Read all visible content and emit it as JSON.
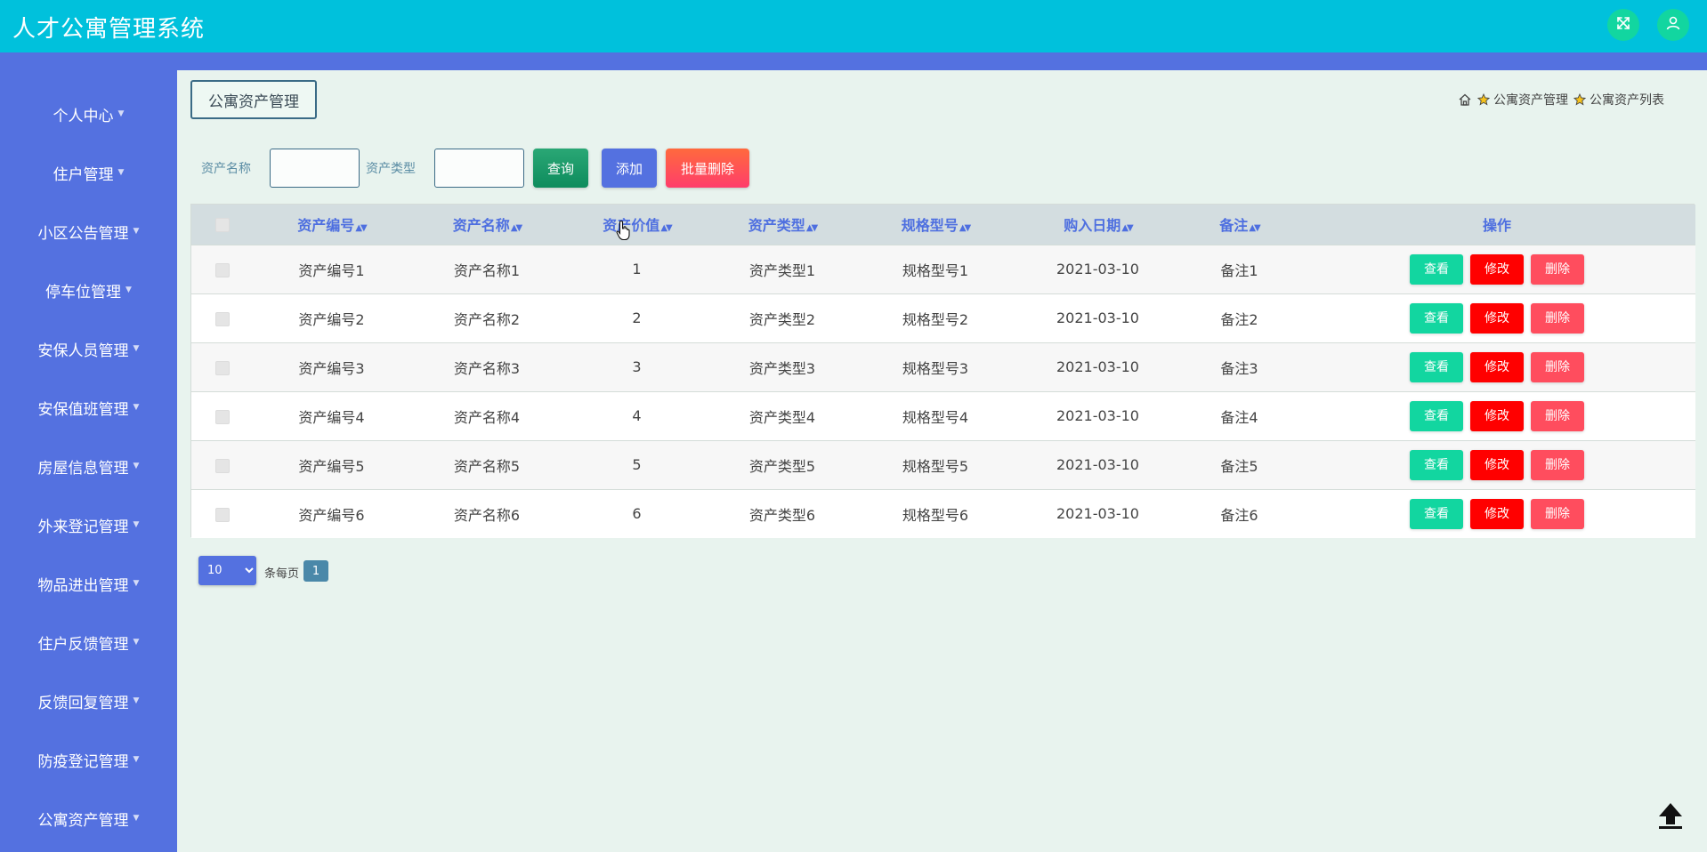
{
  "header": {
    "title": "人才公寓管理系统",
    "icons": [
      "expand-icon",
      "user-icon"
    ],
    "colors": {
      "header_bg": "#00c1dc",
      "accent": "#5471e0",
      "icon_btn": "#12d6a0"
    }
  },
  "sidebar": {
    "items": [
      {
        "label": "个人中心"
      },
      {
        "label": "住户管理"
      },
      {
        "label": "小区公告管理"
      },
      {
        "label": "停车位管理"
      },
      {
        "label": "安保人员管理"
      },
      {
        "label": "安保值班管理"
      },
      {
        "label": "房屋信息管理"
      },
      {
        "label": "外来登记管理"
      },
      {
        "label": "物品进出管理"
      },
      {
        "label": "住户反馈管理"
      },
      {
        "label": "反馈回复管理"
      },
      {
        "label": "防疫登记管理"
      },
      {
        "label": "公寓资产管理"
      }
    ]
  },
  "page_tab": "公寓资产管理",
  "breadcrumb": {
    "items": [
      "公寓资产管理",
      "公寓资产列表"
    ]
  },
  "search": {
    "name_label": "资产名称",
    "name_value": "",
    "type_label": "资产类型",
    "type_value": "",
    "query_label": "查询",
    "add_label": "添加",
    "batch_delete_label": "批量删除"
  },
  "table": {
    "columns": [
      "资产编号",
      "资产名称",
      "资产价值",
      "资产类型",
      "规格型号",
      "购入日期",
      "备注",
      "操作"
    ],
    "rows": [
      {
        "code": "资产编号1",
        "name": "资产名称1",
        "value": "1",
        "type": "资产类型1",
        "spec": "规格型号1",
        "date": "2021-03-10",
        "note": "备注1"
      },
      {
        "code": "资产编号2",
        "name": "资产名称2",
        "value": "2",
        "type": "资产类型2",
        "spec": "规格型号2",
        "date": "2021-03-10",
        "note": "备注2"
      },
      {
        "code": "资产编号3",
        "name": "资产名称3",
        "value": "3",
        "type": "资产类型3",
        "spec": "规格型号3",
        "date": "2021-03-10",
        "note": "备注3"
      },
      {
        "code": "资产编号4",
        "name": "资产名称4",
        "value": "4",
        "type": "资产类型4",
        "spec": "规格型号4",
        "date": "2021-03-10",
        "note": "备注4"
      },
      {
        "code": "资产编号5",
        "name": "资产名称5",
        "value": "5",
        "type": "资产类型5",
        "spec": "规格型号5",
        "date": "2021-03-10",
        "note": "备注5"
      },
      {
        "code": "资产编号6",
        "name": "资产名称6",
        "value": "6",
        "type": "资产类型6",
        "spec": "规格型号6",
        "date": "2021-03-10",
        "note": "备注6"
      }
    ],
    "actions": {
      "view": "查看",
      "edit": "修改",
      "delete": "删除"
    }
  },
  "pagination": {
    "page_size": "10",
    "per_page_label": "条每页",
    "current_page": "1"
  }
}
